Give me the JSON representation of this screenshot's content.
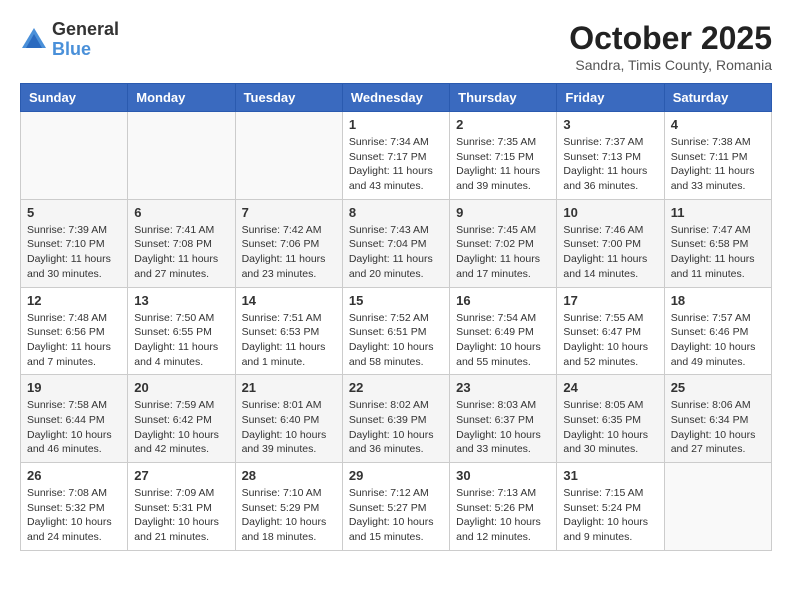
{
  "logo": {
    "general": "General",
    "blue": "Blue"
  },
  "title": "October 2025",
  "subtitle": "Sandra, Timis County, Romania",
  "days_of_week": [
    "Sunday",
    "Monday",
    "Tuesday",
    "Wednesday",
    "Thursday",
    "Friday",
    "Saturday"
  ],
  "weeks": [
    [
      {
        "day": "",
        "info": ""
      },
      {
        "day": "",
        "info": ""
      },
      {
        "day": "",
        "info": ""
      },
      {
        "day": "1",
        "info": "Sunrise: 7:34 AM\nSunset: 7:17 PM\nDaylight: 11 hours and 43 minutes."
      },
      {
        "day": "2",
        "info": "Sunrise: 7:35 AM\nSunset: 7:15 PM\nDaylight: 11 hours and 39 minutes."
      },
      {
        "day": "3",
        "info": "Sunrise: 7:37 AM\nSunset: 7:13 PM\nDaylight: 11 hours and 36 minutes."
      },
      {
        "day": "4",
        "info": "Sunrise: 7:38 AM\nSunset: 7:11 PM\nDaylight: 11 hours and 33 minutes."
      }
    ],
    [
      {
        "day": "5",
        "info": "Sunrise: 7:39 AM\nSunset: 7:10 PM\nDaylight: 11 hours and 30 minutes."
      },
      {
        "day": "6",
        "info": "Sunrise: 7:41 AM\nSunset: 7:08 PM\nDaylight: 11 hours and 27 minutes."
      },
      {
        "day": "7",
        "info": "Sunrise: 7:42 AM\nSunset: 7:06 PM\nDaylight: 11 hours and 23 minutes."
      },
      {
        "day": "8",
        "info": "Sunrise: 7:43 AM\nSunset: 7:04 PM\nDaylight: 11 hours and 20 minutes."
      },
      {
        "day": "9",
        "info": "Sunrise: 7:45 AM\nSunset: 7:02 PM\nDaylight: 11 hours and 17 minutes."
      },
      {
        "day": "10",
        "info": "Sunrise: 7:46 AM\nSunset: 7:00 PM\nDaylight: 11 hours and 14 minutes."
      },
      {
        "day": "11",
        "info": "Sunrise: 7:47 AM\nSunset: 6:58 PM\nDaylight: 11 hours and 11 minutes."
      }
    ],
    [
      {
        "day": "12",
        "info": "Sunrise: 7:48 AM\nSunset: 6:56 PM\nDaylight: 11 hours and 7 minutes."
      },
      {
        "day": "13",
        "info": "Sunrise: 7:50 AM\nSunset: 6:55 PM\nDaylight: 11 hours and 4 minutes."
      },
      {
        "day": "14",
        "info": "Sunrise: 7:51 AM\nSunset: 6:53 PM\nDaylight: 11 hours and 1 minute."
      },
      {
        "day": "15",
        "info": "Sunrise: 7:52 AM\nSunset: 6:51 PM\nDaylight: 10 hours and 58 minutes."
      },
      {
        "day": "16",
        "info": "Sunrise: 7:54 AM\nSunset: 6:49 PM\nDaylight: 10 hours and 55 minutes."
      },
      {
        "day": "17",
        "info": "Sunrise: 7:55 AM\nSunset: 6:47 PM\nDaylight: 10 hours and 52 minutes."
      },
      {
        "day": "18",
        "info": "Sunrise: 7:57 AM\nSunset: 6:46 PM\nDaylight: 10 hours and 49 minutes."
      }
    ],
    [
      {
        "day": "19",
        "info": "Sunrise: 7:58 AM\nSunset: 6:44 PM\nDaylight: 10 hours and 46 minutes."
      },
      {
        "day": "20",
        "info": "Sunrise: 7:59 AM\nSunset: 6:42 PM\nDaylight: 10 hours and 42 minutes."
      },
      {
        "day": "21",
        "info": "Sunrise: 8:01 AM\nSunset: 6:40 PM\nDaylight: 10 hours and 39 minutes."
      },
      {
        "day": "22",
        "info": "Sunrise: 8:02 AM\nSunset: 6:39 PM\nDaylight: 10 hours and 36 minutes."
      },
      {
        "day": "23",
        "info": "Sunrise: 8:03 AM\nSunset: 6:37 PM\nDaylight: 10 hours and 33 minutes."
      },
      {
        "day": "24",
        "info": "Sunrise: 8:05 AM\nSunset: 6:35 PM\nDaylight: 10 hours and 30 minutes."
      },
      {
        "day": "25",
        "info": "Sunrise: 8:06 AM\nSunset: 6:34 PM\nDaylight: 10 hours and 27 minutes."
      }
    ],
    [
      {
        "day": "26",
        "info": "Sunrise: 7:08 AM\nSunset: 5:32 PM\nDaylight: 10 hours and 24 minutes."
      },
      {
        "day": "27",
        "info": "Sunrise: 7:09 AM\nSunset: 5:31 PM\nDaylight: 10 hours and 21 minutes."
      },
      {
        "day": "28",
        "info": "Sunrise: 7:10 AM\nSunset: 5:29 PM\nDaylight: 10 hours and 18 minutes."
      },
      {
        "day": "29",
        "info": "Sunrise: 7:12 AM\nSunset: 5:27 PM\nDaylight: 10 hours and 15 minutes."
      },
      {
        "day": "30",
        "info": "Sunrise: 7:13 AM\nSunset: 5:26 PM\nDaylight: 10 hours and 12 minutes."
      },
      {
        "day": "31",
        "info": "Sunrise: 7:15 AM\nSunset: 5:24 PM\nDaylight: 10 hours and 9 minutes."
      },
      {
        "day": "",
        "info": ""
      }
    ]
  ]
}
